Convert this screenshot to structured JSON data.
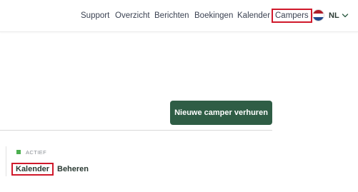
{
  "nav": {
    "items": [
      {
        "label": "Support"
      },
      {
        "label": "Overzicht"
      },
      {
        "label": "Berichten"
      },
      {
        "label": "Boekingen"
      },
      {
        "label": "Kalender"
      },
      {
        "label": "Campers"
      }
    ],
    "highlighted_item": "Campers",
    "language": {
      "code": "NL",
      "flag_icon": "netherlands-flag-icon",
      "flag_colors": [
        "#ae1c28",
        "#ffffff",
        "#21468b"
      ],
      "dropdown_icon": "chevron-down-icon"
    }
  },
  "main": {
    "primary_button": "Nieuwe camper verhuren",
    "listing": {
      "status": "ACTIEF",
      "status_color": "#4caf50",
      "tabs": [
        {
          "label": "Kalender"
        },
        {
          "label": "Beheren"
        }
      ],
      "highlighted_tab": "Kalender"
    }
  },
  "colors": {
    "accent": "#2f5d45",
    "highlight_outline": "#d0192b"
  }
}
